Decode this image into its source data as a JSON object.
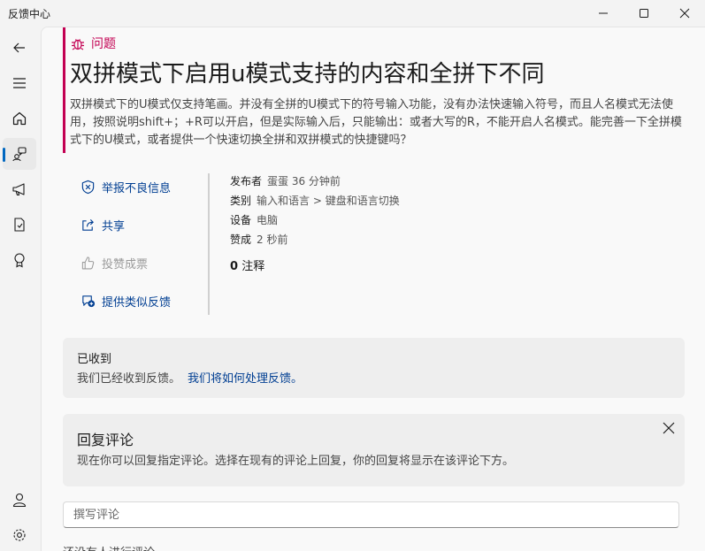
{
  "window": {
    "title": "反馈中心"
  },
  "feedback": {
    "category": "问题",
    "title": "双拼模式下启用u模式支持的内容和全拼下不同",
    "description": "双拼模式下的U模式仅支持笔画。并没有全拼的U模式下的符号输入功能，没有办法快速输入符号，而且人名模式无法使用，按照说明shift+；+R可以开启，但是实际输入后，只能输出：或者大写的R，不能开启人名模式。能完善一下全拼模式下的U模式，或者提供一个快速切换全拼和双拼模式的快捷键吗？"
  },
  "actions": {
    "report": "举报不良信息",
    "share": "共享",
    "upvote": "投赞成票",
    "similar": "提供类似反馈"
  },
  "meta": {
    "publisher_label": "发布者",
    "publisher_value": "蛋蛋 36 分钟前",
    "category_label": "类别",
    "category_value": "输入和语言 > 键盘和语言切换",
    "device_label": "设备",
    "device_value": "电脑",
    "upvote_label": "赞成",
    "upvote_value": "2 秒前",
    "comment_count": "0",
    "comment_label": "注释"
  },
  "received": {
    "heading": "已收到",
    "text": "我们已经收到反馈。",
    "link": "我们将如何处理反馈。"
  },
  "reply": {
    "heading": "回复评论",
    "text": "现在你可以回复指定评论。选择在现有的评论上回复，你的回复将显示在该评论下方。"
  },
  "comment_input": {
    "placeholder": "撰写评论"
  },
  "empty_comments": "还没有人进行评论",
  "colors": {
    "accent": "#0067c0",
    "category": "#c30052",
    "link": "#003e92"
  }
}
